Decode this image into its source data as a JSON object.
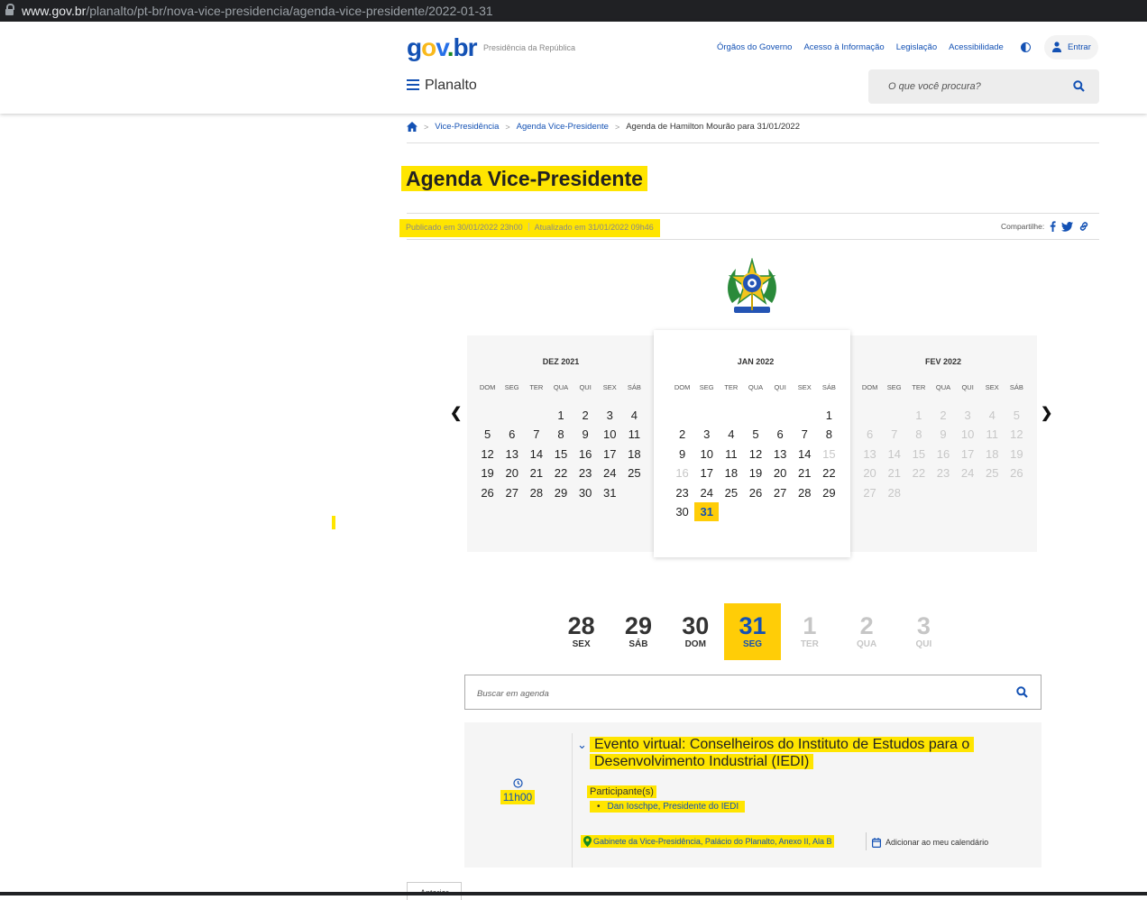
{
  "browser": {
    "url_host": "www.gov.br",
    "url_path": "/planalto/pt-br/nova-vice-presidencia/agenda-vice-presidente/2022-01-31"
  },
  "header": {
    "logo": {
      "g": "g",
      "o": "o",
      "v": "v",
      "dot": ".",
      "br": "br"
    },
    "subtitle": "Presidência da República",
    "links": [
      "Órgãos do Governo",
      "Acesso à Informação",
      "Legislação",
      "Acessibilidade"
    ],
    "login_label": "Entrar",
    "menu_label": "Planalto",
    "search_placeholder": "O que você procura?"
  },
  "breadcrumb": {
    "items": [
      "Vice-Presidência",
      "Agenda Vice-Presidente"
    ],
    "current": "Agenda de Hamilton Mourão para 31/01/2022"
  },
  "page": {
    "title": "Agenda Vice-Presidente",
    "published": "Publicado em 30/01/2022 23h00",
    "updated": "Atualizado em 31/01/2022 09h46",
    "share_label": "Compartilhe:"
  },
  "calendar": {
    "weekdays": [
      "DOM",
      "SEG",
      "TER",
      "QUA",
      "QUI",
      "SEX",
      "SÁB"
    ],
    "months": [
      {
        "title": "DEZ 2021",
        "offset": 3,
        "days": 31,
        "dim_from": null,
        "dim_days": [],
        "selected": null
      },
      {
        "title": "JAN 2022",
        "offset": 6,
        "days": 31,
        "dim_days": [
          15,
          16
        ],
        "selected": 31
      },
      {
        "title": "FEV 2022",
        "offset": 2,
        "days": 28,
        "dim_all": true,
        "selected": null
      }
    ]
  },
  "day_strip": [
    {
      "n": "28",
      "w": "SEX",
      "state": "past"
    },
    {
      "n": "29",
      "w": "SÁB",
      "state": "past"
    },
    {
      "n": "30",
      "w": "DOM",
      "state": "past"
    },
    {
      "n": "31",
      "w": "SEG",
      "state": "selected"
    },
    {
      "n": "1",
      "w": "TER",
      "state": "future"
    },
    {
      "n": "2",
      "w": "QUA",
      "state": "future"
    },
    {
      "n": "3",
      "w": "QUI",
      "state": "future"
    }
  ],
  "agenda_search_placeholder": "Buscar em agenda",
  "event": {
    "time": "11h00",
    "title": "Evento virtual: Conselheiros do Instituto de Estudos para o Desenvolvimento Industrial (IEDI)",
    "participants_label": "Participante(s)",
    "participants": [
      "Dan Ioschpe, Presidente do IEDI"
    ],
    "location": "Gabinete da Vice-Presidência, Palácio do Planalto, Anexo II, Ala B",
    "add_calendar": "Adicionar ao meu calendário"
  },
  "pagination": {
    "previous": "Anterior"
  }
}
